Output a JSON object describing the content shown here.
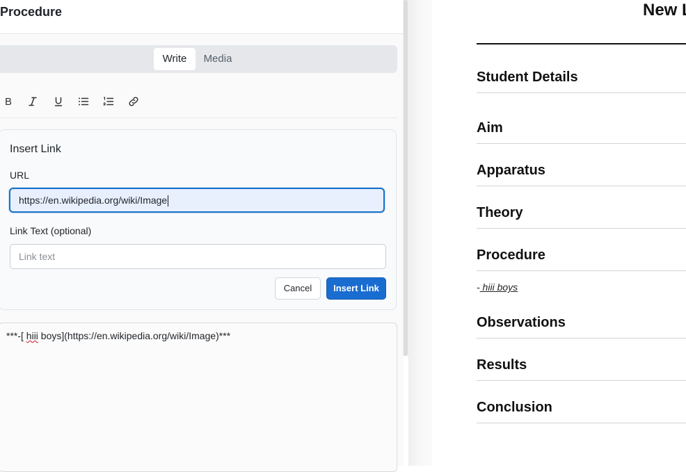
{
  "editor": {
    "title": "Procedure",
    "tabs": [
      {
        "label": "Write",
        "active": true
      },
      {
        "label": "Media",
        "active": false
      }
    ],
    "toolbar": {
      "buttons": [
        "bold-icon",
        "italic-icon",
        "underline-icon",
        "bullet-list-icon",
        "numbered-list-icon",
        "link-icon"
      ],
      "bold_glyph": "B"
    },
    "insert_link": {
      "title": "Insert Link",
      "url_label": "URL",
      "url_value": "https://en.wikipedia.org/wiki/Image",
      "link_text_label": "Link Text (optional)",
      "link_text_placeholder": "Link text",
      "cancel_label": "Cancel",
      "insert_label": "Insert Link"
    },
    "markdown": {
      "prefix": "***-[ ",
      "misspelled": "hiii",
      "rest": " boys](https://en.wikipedia.org/wiki/Image)***"
    }
  },
  "preview": {
    "title": "New L",
    "sections": [
      {
        "heading": "Student Details"
      },
      {
        "heading": "Aim"
      },
      {
        "heading": "Apparatus"
      },
      {
        "heading": "Theory"
      },
      {
        "heading": "Procedure"
      },
      {
        "heading": "Observations"
      },
      {
        "heading": "Results"
      },
      {
        "heading": "Conclusion"
      }
    ],
    "procedure_dash": "-",
    "procedure_link_text": " hiii boys"
  },
  "colors": {
    "primary": "#1a6dd0",
    "focus_border": "#1a73c8",
    "input_focus_bg": "#e8f0fe"
  }
}
